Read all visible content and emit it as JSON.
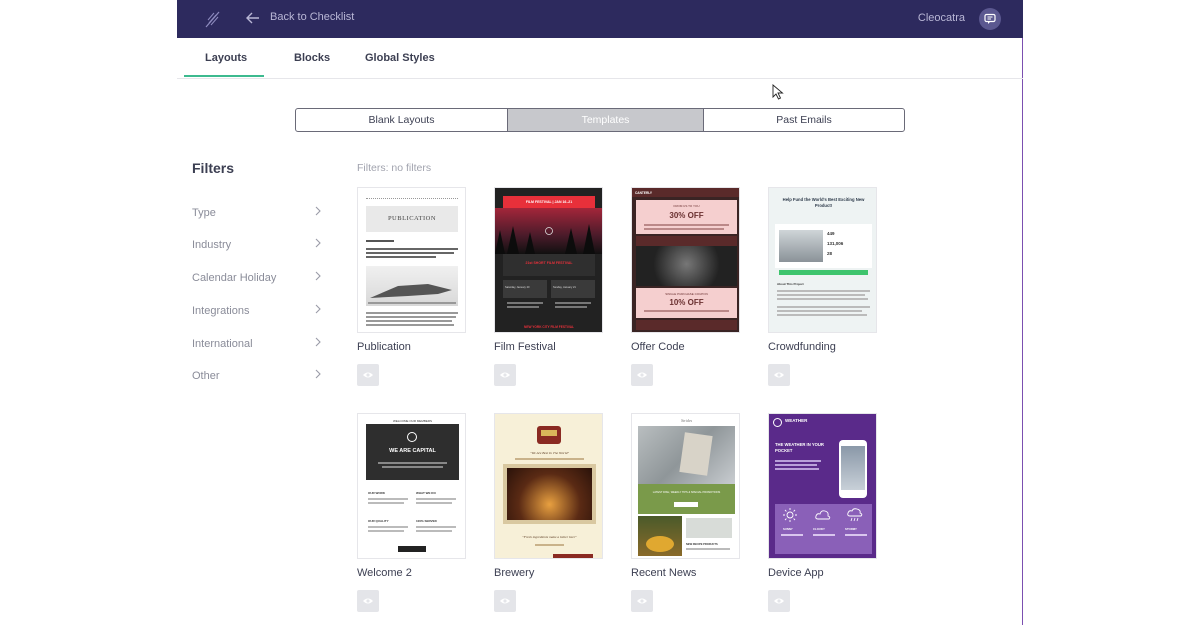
{
  "topbar": {
    "back_label": "Back to Checklist",
    "user_name": "Cleocatra"
  },
  "tabs": [
    {
      "label": "Layouts",
      "active": true
    },
    {
      "label": "Blocks",
      "active": false
    },
    {
      "label": "Global Styles",
      "active": false
    }
  ],
  "segmented": [
    {
      "label": "Blank Layouts",
      "active": false
    },
    {
      "label": "Templates",
      "active": true
    },
    {
      "label": "Past Emails",
      "active": false
    }
  ],
  "filters": {
    "title": "Filters",
    "status": "Filters: no filters",
    "items": [
      "Type",
      "Industry",
      "Calendar Holiday",
      "Integrations",
      "International",
      "Other"
    ]
  },
  "templates": [
    {
      "name": "Publication",
      "preview": {
        "masthead": "PUBLICATION"
      }
    },
    {
      "name": "Film Festival",
      "preview": {
        "banner": "FILM FESTIVAL | JAN 16–21",
        "heading": "21st SHORT FILM FESTIVAL",
        "date_1": "Saturday, January 20",
        "date_2": "Sunday, January 21",
        "footer": "NEW YORK CITY FILM FESTIVAL"
      }
    },
    {
      "name": "Offer Code",
      "preview": {
        "brand": "CANTERLY",
        "kicker_1": "FROM US TO YOU",
        "offer_1": "30% OFF",
        "kicker_2": "SINGLE PURCHASE COUPON",
        "offer_2": "10% OFF"
      }
    },
    {
      "name": "Crowdfunding",
      "preview": {
        "headline": "Help Fund the World's Best Exciting New Product!",
        "stat_1": "449",
        "stat_2": "131,006",
        "stat_3": "28",
        "section": "About This Project"
      }
    },
    {
      "name": "Welcome 2",
      "preview": {
        "kicker": "WELCOME OUR MEMBERS",
        "headline": "WE ARE CAPITAL",
        "col_1": "OUR WORK",
        "col_2": "WHAT WE DO",
        "col_3": "OUR QUALITY",
        "col_4": "100% SERVED"
      }
    },
    {
      "name": "Brewery",
      "preview": {
        "tagline": "\"We Are Best In The World\"",
        "caption": "\"Fresh ingredients make a better beer\""
      }
    },
    {
      "name": "Recent News",
      "preview": {
        "brand": "Strides",
        "headline": "LATEST DISH, WEEKLY TIPS & SPECIAL PROMOTIONS",
        "subhead": "NEW RECIPE PRODUCTS"
      }
    },
    {
      "name": "Device App",
      "preview": {
        "brand": "WEATHER",
        "headline": "THE WEATHER IN YOUR POCKET",
        "icon_1": "SUNNY",
        "icon_2": "CLOUDY",
        "icon_3": "STORMY"
      }
    }
  ],
  "colors": {
    "topbar": "#2d2a5e",
    "accent": "#3dba8f",
    "segment_active": "#c7c8cc"
  }
}
